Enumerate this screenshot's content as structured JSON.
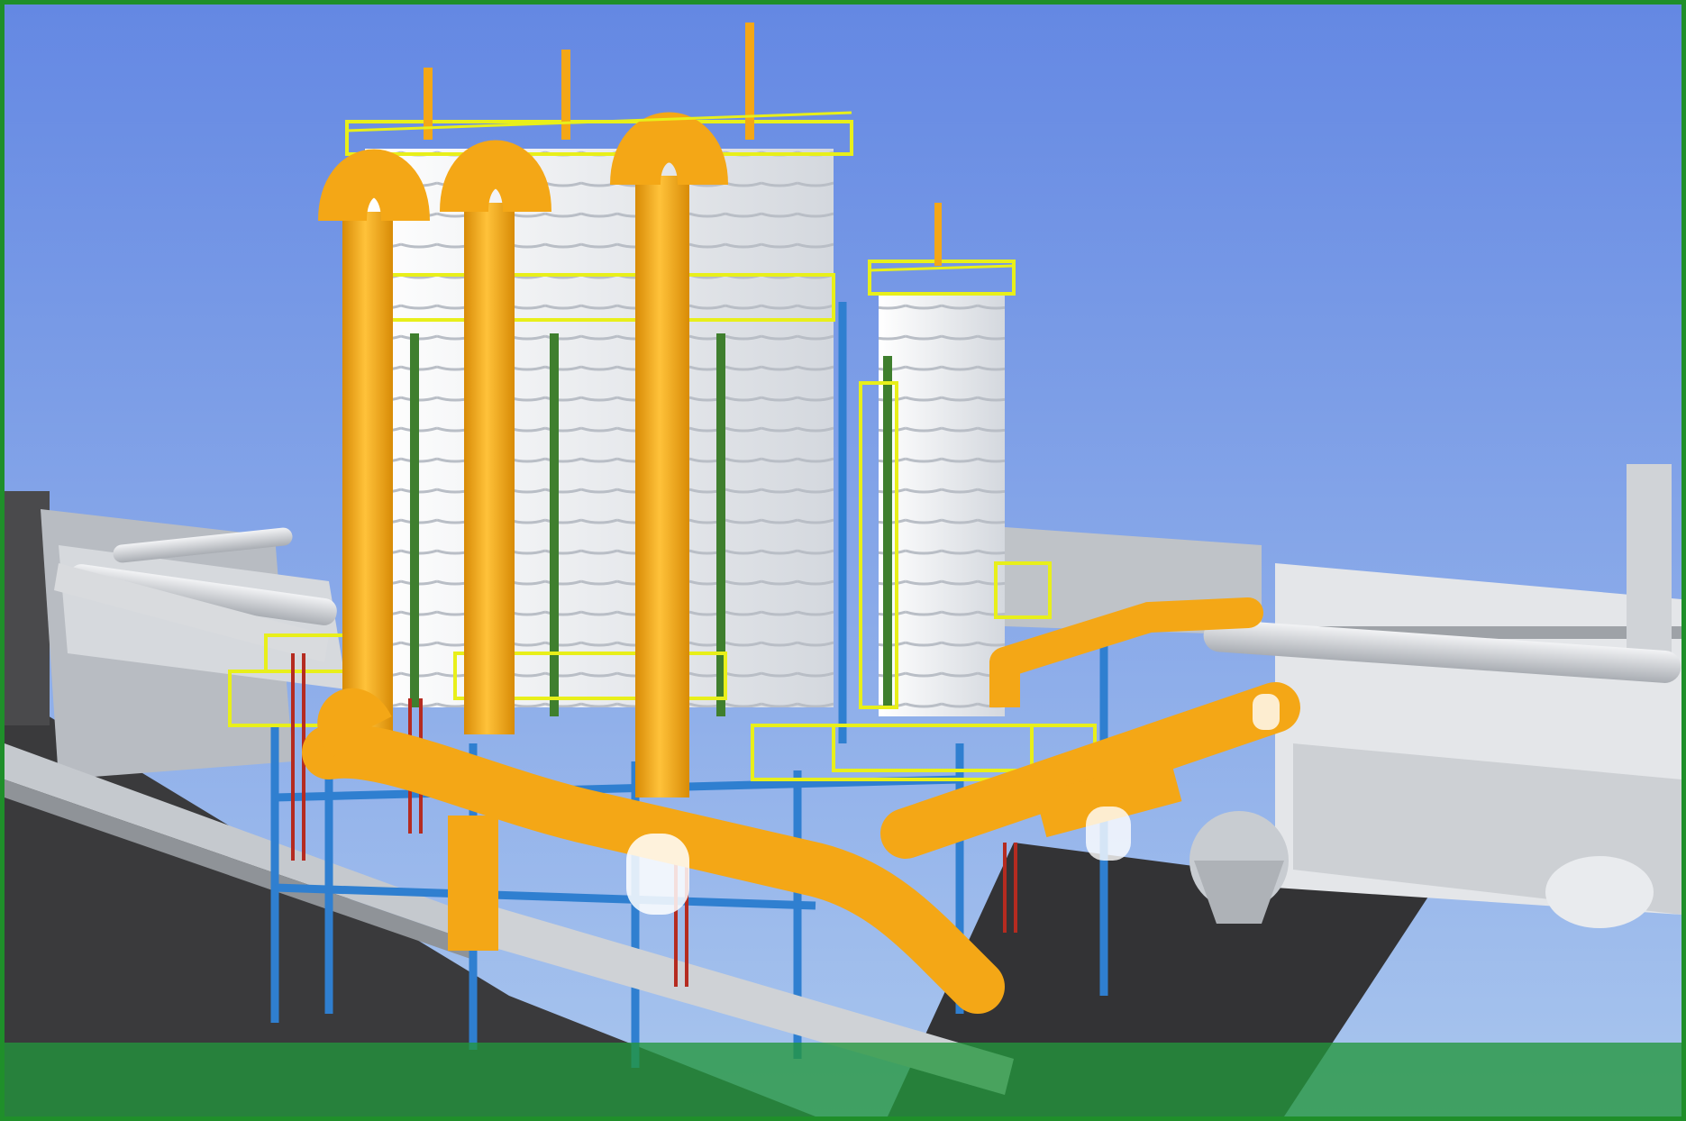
{
  "image": {
    "subject": "plant-3d-model-render",
    "colors": {
      "frame": "#1f8f2a",
      "sky_top": "#6488e3",
      "sky_bottom": "#a9c6ee",
      "pipe": "#f4a716",
      "pipe_shade": "#d88b06",
      "steel": "#2f7fd0",
      "railing": "#e8ef1a",
      "tower": "#eef1f4",
      "ground": "#3a3a3c",
      "gray_pipe": "#c9cdd2",
      "band": "#22963c"
    }
  }
}
